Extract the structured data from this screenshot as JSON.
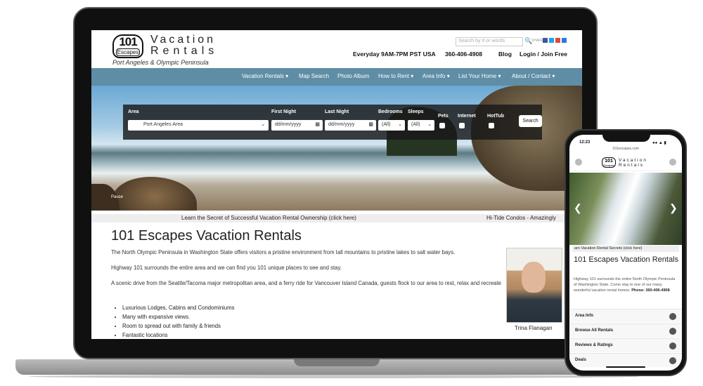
{
  "site": {
    "logo_number": "101",
    "logo_sub": "Escapes",
    "logo_word1": "Vacation",
    "logo_word2": "Rentals",
    "tagline": "Port Angeles & Olympic Peninsula",
    "search_placeholder": "Search by # or words",
    "share_label": "SHARE",
    "hours": "Everyday 9AM-7PM PST USA",
    "phone": "360-406-4908",
    "blog": "Blog",
    "login": "Login / Join Free"
  },
  "nav": {
    "items": [
      "Vacation Rentals ▾",
      "Map Search",
      "Photo Album",
      "How to Rent ▾",
      "Area Info ▾",
      "List Your Home ▾",
      "About / Contact ▾"
    ]
  },
  "search_panel": {
    "area_label": "Area",
    "area_value": "Port Angeles Area",
    "first_night_label": "First Night",
    "first_night_value": "dd/mm/yyyy",
    "last_night_label": "Last Night",
    "last_night_value": "dd/mm/yyyy",
    "bedrooms_label": "Bedrooms",
    "bedrooms_value": "(All)",
    "sleeps_label": "Sleeps",
    "sleeps_value": "(All)",
    "pets_label": "Pets",
    "internet_label": "Internet",
    "hottub_label": "HotTub",
    "search_button": "Search"
  },
  "hero": {
    "pause_label": "Pause"
  },
  "ticker": {
    "item1": "Learn the Secret of Successful Vacation Rental Ownership (click here)",
    "item2": "Hi-Tide Condos - Amazingly"
  },
  "content": {
    "title": "101 Escapes Vacation Rentals",
    "p1": "The North Olympic Peninsula in Washington State offers visitors a pristine environment from tall mountains to pristine lakes to salt water bays.",
    "p2": "Highway 101 surrounds the entire area and we can find you 101 unique places to see and stay.",
    "p3": "A scenic drive from the Seattle/Tacoma major metropolitan area, and a ferry ride for Vancouver Island Canada, guests flock to our area to rest, relax and recreate",
    "bullets": [
      "Luxurious Lodges, Cabins and Condominiums",
      "Many with expansive views.",
      "Room to spread out with family & friends",
      "Fantastic locations"
    ],
    "photo_caption": "Trina Flanagan"
  },
  "phone": {
    "time": "12:23",
    "url": "101escapes.com",
    "logo_number": "101",
    "logo_sub": "Escapes",
    "logo_word1": "Vacation",
    "logo_word2": "Rentals",
    "ticker": "arn Vacation Rental Secrets (click here)",
    "title": "101 Escapes Vacation Rentals",
    "paragraph": "Highway 101 surrounds the entire North Olympic Peninsula of Washington State. Come stay in one of our many wonderful vacation rental homes.",
    "phone_label": "Phone: 360-406-4908",
    "menu": [
      "Area Info",
      "Browse All Rentals",
      "Reviews & Ratings",
      "Deals"
    ]
  },
  "colors": {
    "nav_bg": "#5f8da5",
    "search_panel_bg": "#191919",
    "facebook": "#3b5998",
    "twitter": "#1da1f2",
    "google": "#dd4b39",
    "add": "#2a7ae2"
  }
}
